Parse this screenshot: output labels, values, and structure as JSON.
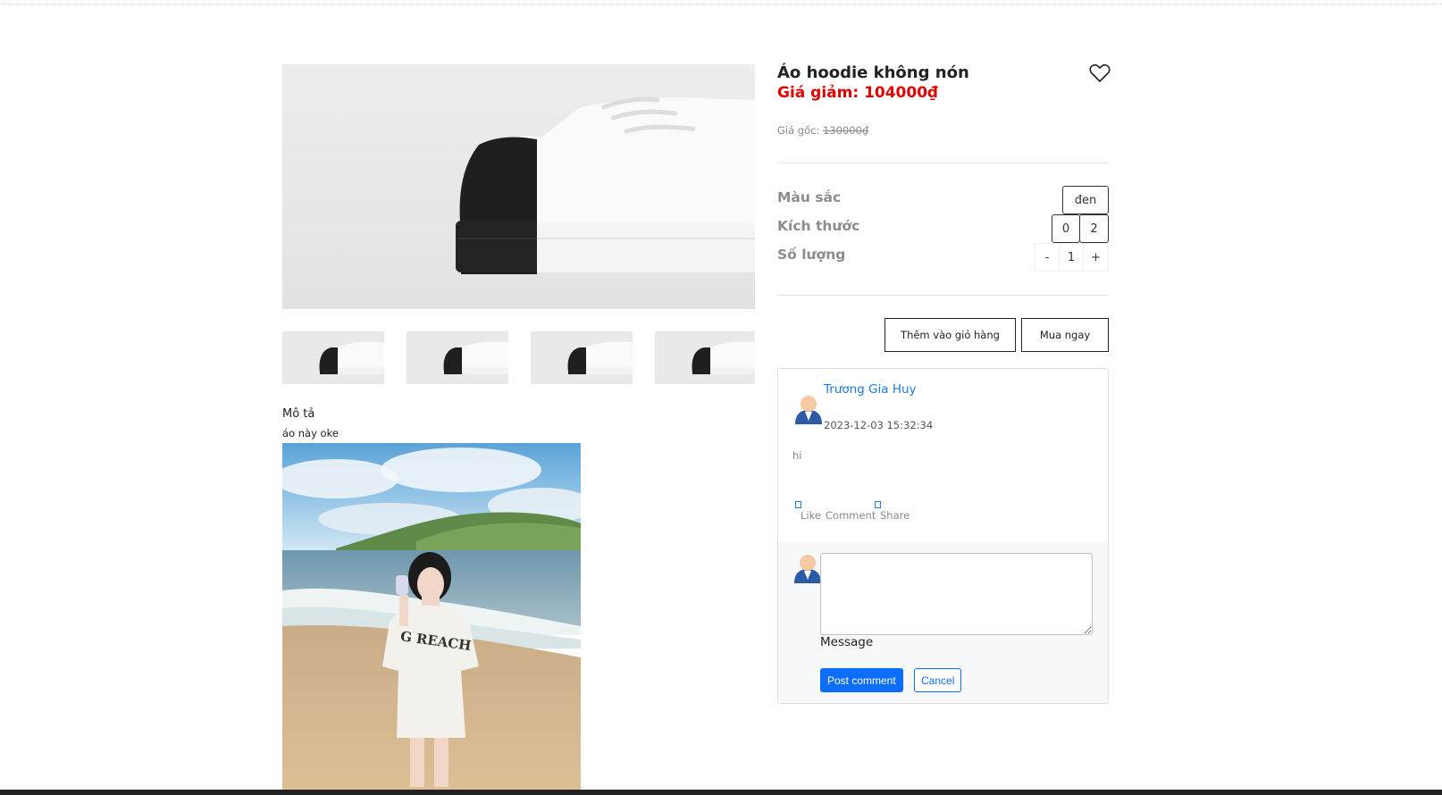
{
  "product": {
    "title": "Áo hoodie không nón",
    "sale_price": "Giá giảm: 104000₫",
    "original_label": "Giá gốc: ",
    "original_price": "130000₫"
  },
  "options": {
    "color_label": "Màu sắc",
    "color_value": "đen",
    "size_label": "Kích thước",
    "sizes": [
      "0",
      "2"
    ],
    "quantity_label": "Số lượng",
    "qty_minus": "-",
    "qty_value": "1",
    "qty_plus": "+"
  },
  "actions": {
    "add_to_cart": "Thêm vào giỏ hàng",
    "buy_now": "Mua ngay"
  },
  "description": {
    "title": "Mô tả",
    "text": "áo này oke"
  },
  "comment": {
    "author": "Trương Gia Huy",
    "date": "2023-12-03 15:32:34",
    "text": "hi",
    "like_label": "Like",
    "comment_label": "Comment",
    "share_label": "Share"
  },
  "comment_form": {
    "message_label": "Message",
    "post_label": "Post comment",
    "cancel_label": "Cancel"
  },
  "colors": {
    "sale": "#e00000",
    "link": "#1e7be0",
    "primary": "#0d6efd"
  }
}
